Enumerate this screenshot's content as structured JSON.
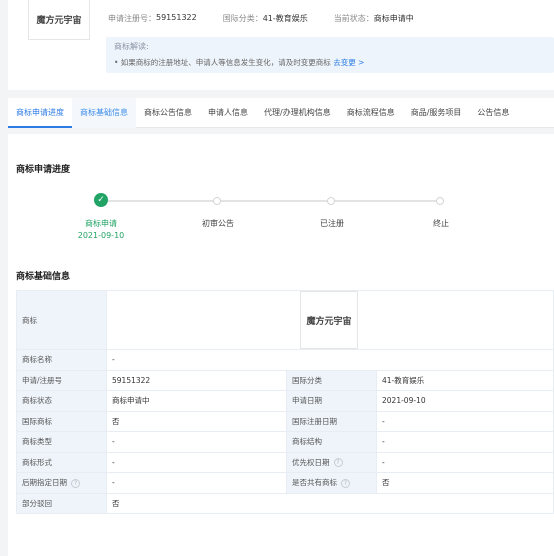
{
  "header": {
    "logo_text": "魔方元宇宙",
    "reg_no_label": "申请注册号：",
    "reg_no": "59151322",
    "intl_class_label": "国际分类：",
    "intl_class": "41-教育娱乐",
    "status_label": "当前状态：",
    "status": "商标申请中",
    "note_title": "商标解读:",
    "note_body": "• 如果商标的注册地址、申请人等信息发生变化，请及时变更商标",
    "note_link": "去变更 >"
  },
  "tabs": [
    "商标申请进度",
    "商标基础信息",
    "商标公告信息",
    "申请人信息",
    "代理/办理机构信息",
    "商标流程信息",
    "商品/服务项目",
    "公告信息"
  ],
  "progress": {
    "title": "商标申请进度",
    "steps": [
      {
        "label": "商标申请",
        "date": "2021-09-10",
        "done": true
      },
      {
        "label": "初审公告",
        "date": "",
        "done": false
      },
      {
        "label": "已注册",
        "date": "",
        "done": false
      },
      {
        "label": "终止",
        "date": "",
        "done": false
      }
    ],
    "check_icon": "✓"
  },
  "basic": {
    "title": "商标基础信息",
    "trademark_label": "商标",
    "trademark_image_text": "魔方元宇宙",
    "name_label": "商标名称",
    "name_value": "-",
    "rows": [
      {
        "k1": "申请/注册号",
        "v1": "59151322",
        "k2": "国际分类",
        "v2": "41-教育娱乐"
      },
      {
        "k1": "商标状态",
        "v1": "商标申请中",
        "k2": "申请日期",
        "v2": "2021-09-10"
      },
      {
        "k1": "国际商标",
        "v1": "否",
        "k2": "国际注册日期",
        "v2": "-"
      },
      {
        "k1": "商标类型",
        "v1": "-",
        "k2": "商标结构",
        "v2": "-"
      },
      {
        "k1": "商标形式",
        "v1": "-",
        "k2": "优先权日期",
        "v2": "-"
      },
      {
        "k1": "后期指定日期",
        "v1": "-",
        "k2": "是否共有商标",
        "v2": "否"
      }
    ],
    "last_label": "部分驳回",
    "last_value": "否",
    "help_glyph": "?"
  }
}
